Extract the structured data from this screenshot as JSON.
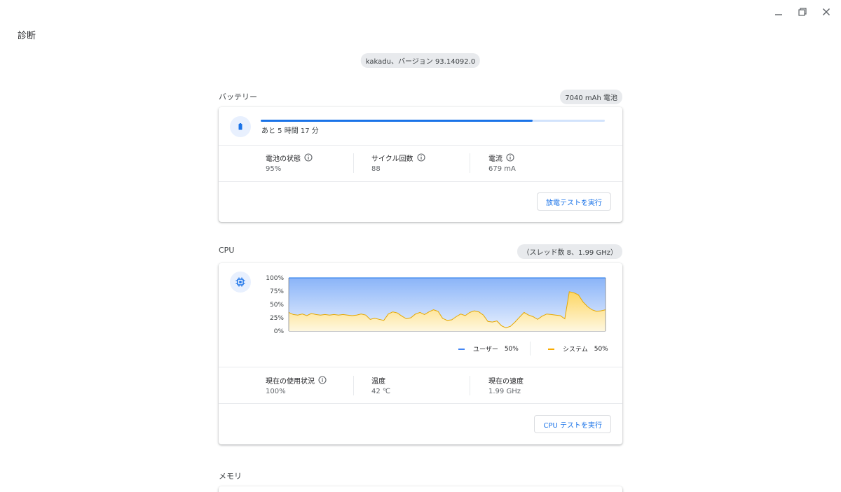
{
  "window": {
    "controls": [
      "minimize-icon",
      "restore-icon",
      "close-icon"
    ]
  },
  "app_title": "診断",
  "version": "kakadu、バージョン 93.14092.0",
  "battery": {
    "title": "バッテリー",
    "capacity": "7040 mAh 電池",
    "icon": "battery-icon",
    "progress_fraction": 0.79,
    "time_remaining": "あと 5 時間 17 分",
    "stats": [
      {
        "label": "電池の状態",
        "value": "95%",
        "info": true
      },
      {
        "label": "サイクル回数",
        "value": "88",
        "info": true
      },
      {
        "label": "電流",
        "value": "679 mA",
        "info": true
      }
    ],
    "button": "放電テストを実行"
  },
  "cpu": {
    "title": "CPU",
    "detail": "（スレッド数 8、1.99 GHz）",
    "icon": "cpu-chip-icon",
    "stats": [
      {
        "label": "現在の使用状況",
        "value": "100%",
        "info": true
      },
      {
        "label": "温度",
        "value": "42 ℃",
        "info": false
      },
      {
        "label": "現在の速度",
        "value": "1.99 GHz",
        "info": false
      }
    ],
    "button": "CPU テストを実行"
  },
  "memory": {
    "title": "メモリ"
  },
  "colors": {
    "accent": "#1a73e8",
    "user_series": "#4285f4",
    "system_series": "#f9ab00"
  },
  "chart_data": {
    "type": "area",
    "ylim": [
      0,
      100
    ],
    "y_ticks": [
      "100%",
      "75%",
      "50%",
      "25%",
      "0%"
    ],
    "y_tick_values": [
      100,
      75,
      50,
      25,
      0
    ],
    "series": [
      {
        "name": "ユーザー",
        "legend_value": "50%",
        "color": "#4285f4",
        "values": [
          100,
          100,
          100,
          100,
          100,
          100,
          100,
          100,
          100,
          100,
          100,
          100,
          100,
          100,
          100,
          100,
          100,
          100,
          100,
          100,
          100,
          100,
          100,
          100,
          100,
          100,
          100,
          100,
          100,
          100,
          100,
          100,
          100,
          100,
          100,
          100,
          100,
          100,
          100,
          100,
          100,
          100,
          100,
          100,
          100,
          100,
          100,
          100,
          100,
          100,
          100,
          100,
          100,
          100,
          100,
          100,
          100,
          100,
          100,
          100,
          100,
          100,
          100,
          100,
          100,
          100,
          100,
          100,
          100,
          100,
          100
        ]
      },
      {
        "name": "システム",
        "legend_value": "50%",
        "color": "#f9ab00",
        "values": [
          35,
          31,
          30,
          32,
          29,
          33,
          31,
          30,
          31,
          30,
          31,
          30,
          31,
          30,
          29,
          30,
          32,
          30,
          22,
          24,
          22,
          20,
          32,
          36,
          34,
          28,
          23,
          25,
          32,
          35,
          31,
          36,
          40,
          37,
          24,
          20,
          21,
          27,
          32,
          29,
          35,
          38,
          36,
          30,
          18,
          17,
          19,
          10,
          6,
          9,
          17,
          26,
          35,
          30,
          27,
          22,
          28,
          32,
          31,
          30,
          29,
          23,
          74,
          72,
          68,
          55,
          46,
          40,
          37,
          38,
          40
        ]
      }
    ]
  }
}
